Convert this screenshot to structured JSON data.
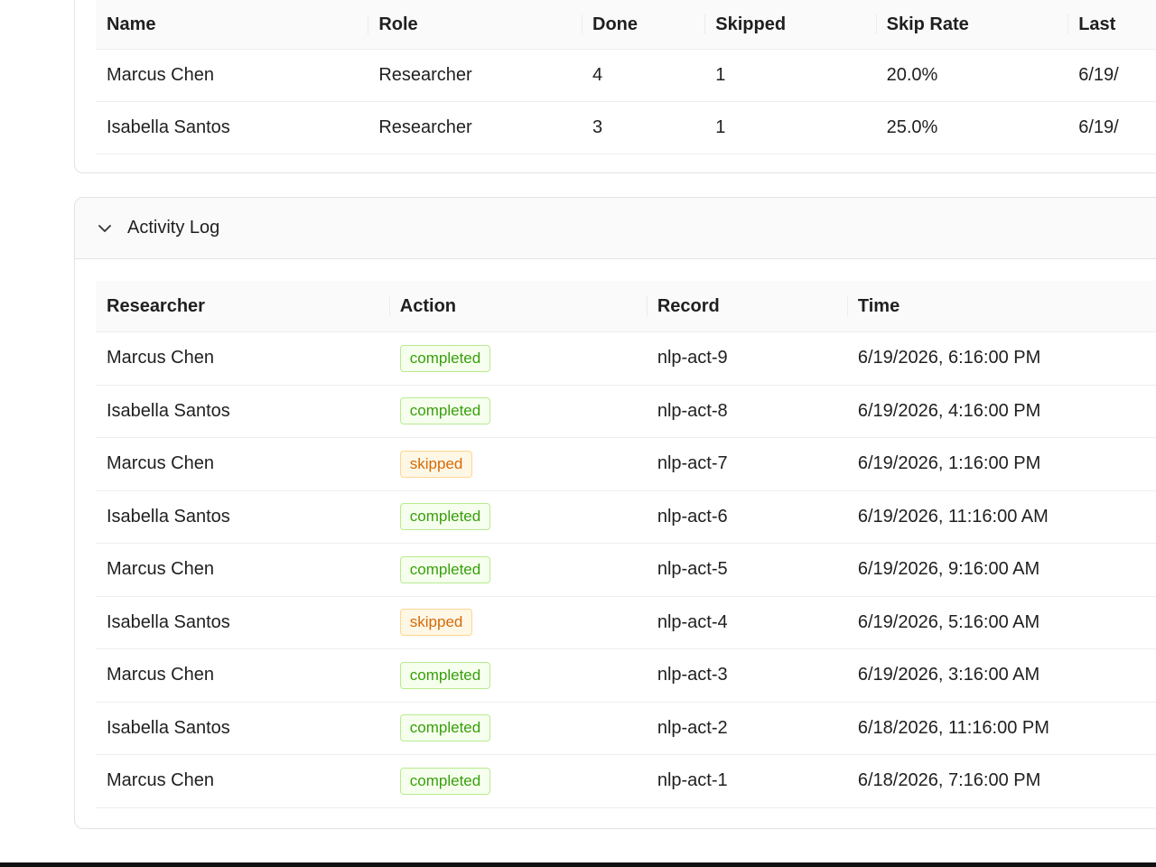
{
  "stats": {
    "columns": [
      "Name",
      "Role",
      "Done",
      "Skipped",
      "Skip Rate",
      "Last"
    ],
    "rows": [
      {
        "name": "Marcus Chen",
        "role": "Researcher",
        "done": "4",
        "skipped": "1",
        "skip_rate": "20.0%",
        "last": "6/19/"
      },
      {
        "name": "Isabella Santos",
        "role": "Researcher",
        "done": "3",
        "skipped": "1",
        "skip_rate": "25.0%",
        "last": "6/19/"
      }
    ]
  },
  "activity": {
    "title": "Activity Log",
    "columns": [
      "Researcher",
      "Action",
      "Record",
      "Time"
    ],
    "rows": [
      {
        "researcher": "Marcus Chen",
        "action": "completed",
        "record": "nlp-act-9",
        "time": "6/19/2026, 6:16:00 PM"
      },
      {
        "researcher": "Isabella Santos",
        "action": "completed",
        "record": "nlp-act-8",
        "time": "6/19/2026, 4:16:00 PM"
      },
      {
        "researcher": "Marcus Chen",
        "action": "skipped",
        "record": "nlp-act-7",
        "time": "6/19/2026, 1:16:00 PM"
      },
      {
        "researcher": "Isabella Santos",
        "action": "completed",
        "record": "nlp-act-6",
        "time": "6/19/2026, 11:16:00 AM"
      },
      {
        "researcher": "Marcus Chen",
        "action": "completed",
        "record": "nlp-act-5",
        "time": "6/19/2026, 9:16:00 AM"
      },
      {
        "researcher": "Isabella Santos",
        "action": "skipped",
        "record": "nlp-act-4",
        "time": "6/19/2026, 5:16:00 AM"
      },
      {
        "researcher": "Marcus Chen",
        "action": "completed",
        "record": "nlp-act-3",
        "time": "6/19/2026, 3:16:00 AM"
      },
      {
        "researcher": "Isabella Santos",
        "action": "completed",
        "record": "nlp-act-2",
        "time": "6/18/2026, 11:16:00 PM"
      },
      {
        "researcher": "Marcus Chen",
        "action": "completed",
        "record": "nlp-act-1",
        "time": "6/18/2026, 7:16:00 PM"
      }
    ]
  },
  "icons": {
    "collapse": "chevron-down-icon"
  },
  "colors": {
    "completed_text": "#389e0d",
    "completed_bg": "#f6ffed",
    "completed_border": "#b7eb8f",
    "skipped_text": "#d46b08",
    "skipped_bg": "#fff7e6",
    "skipped_border": "#ffd591"
  }
}
